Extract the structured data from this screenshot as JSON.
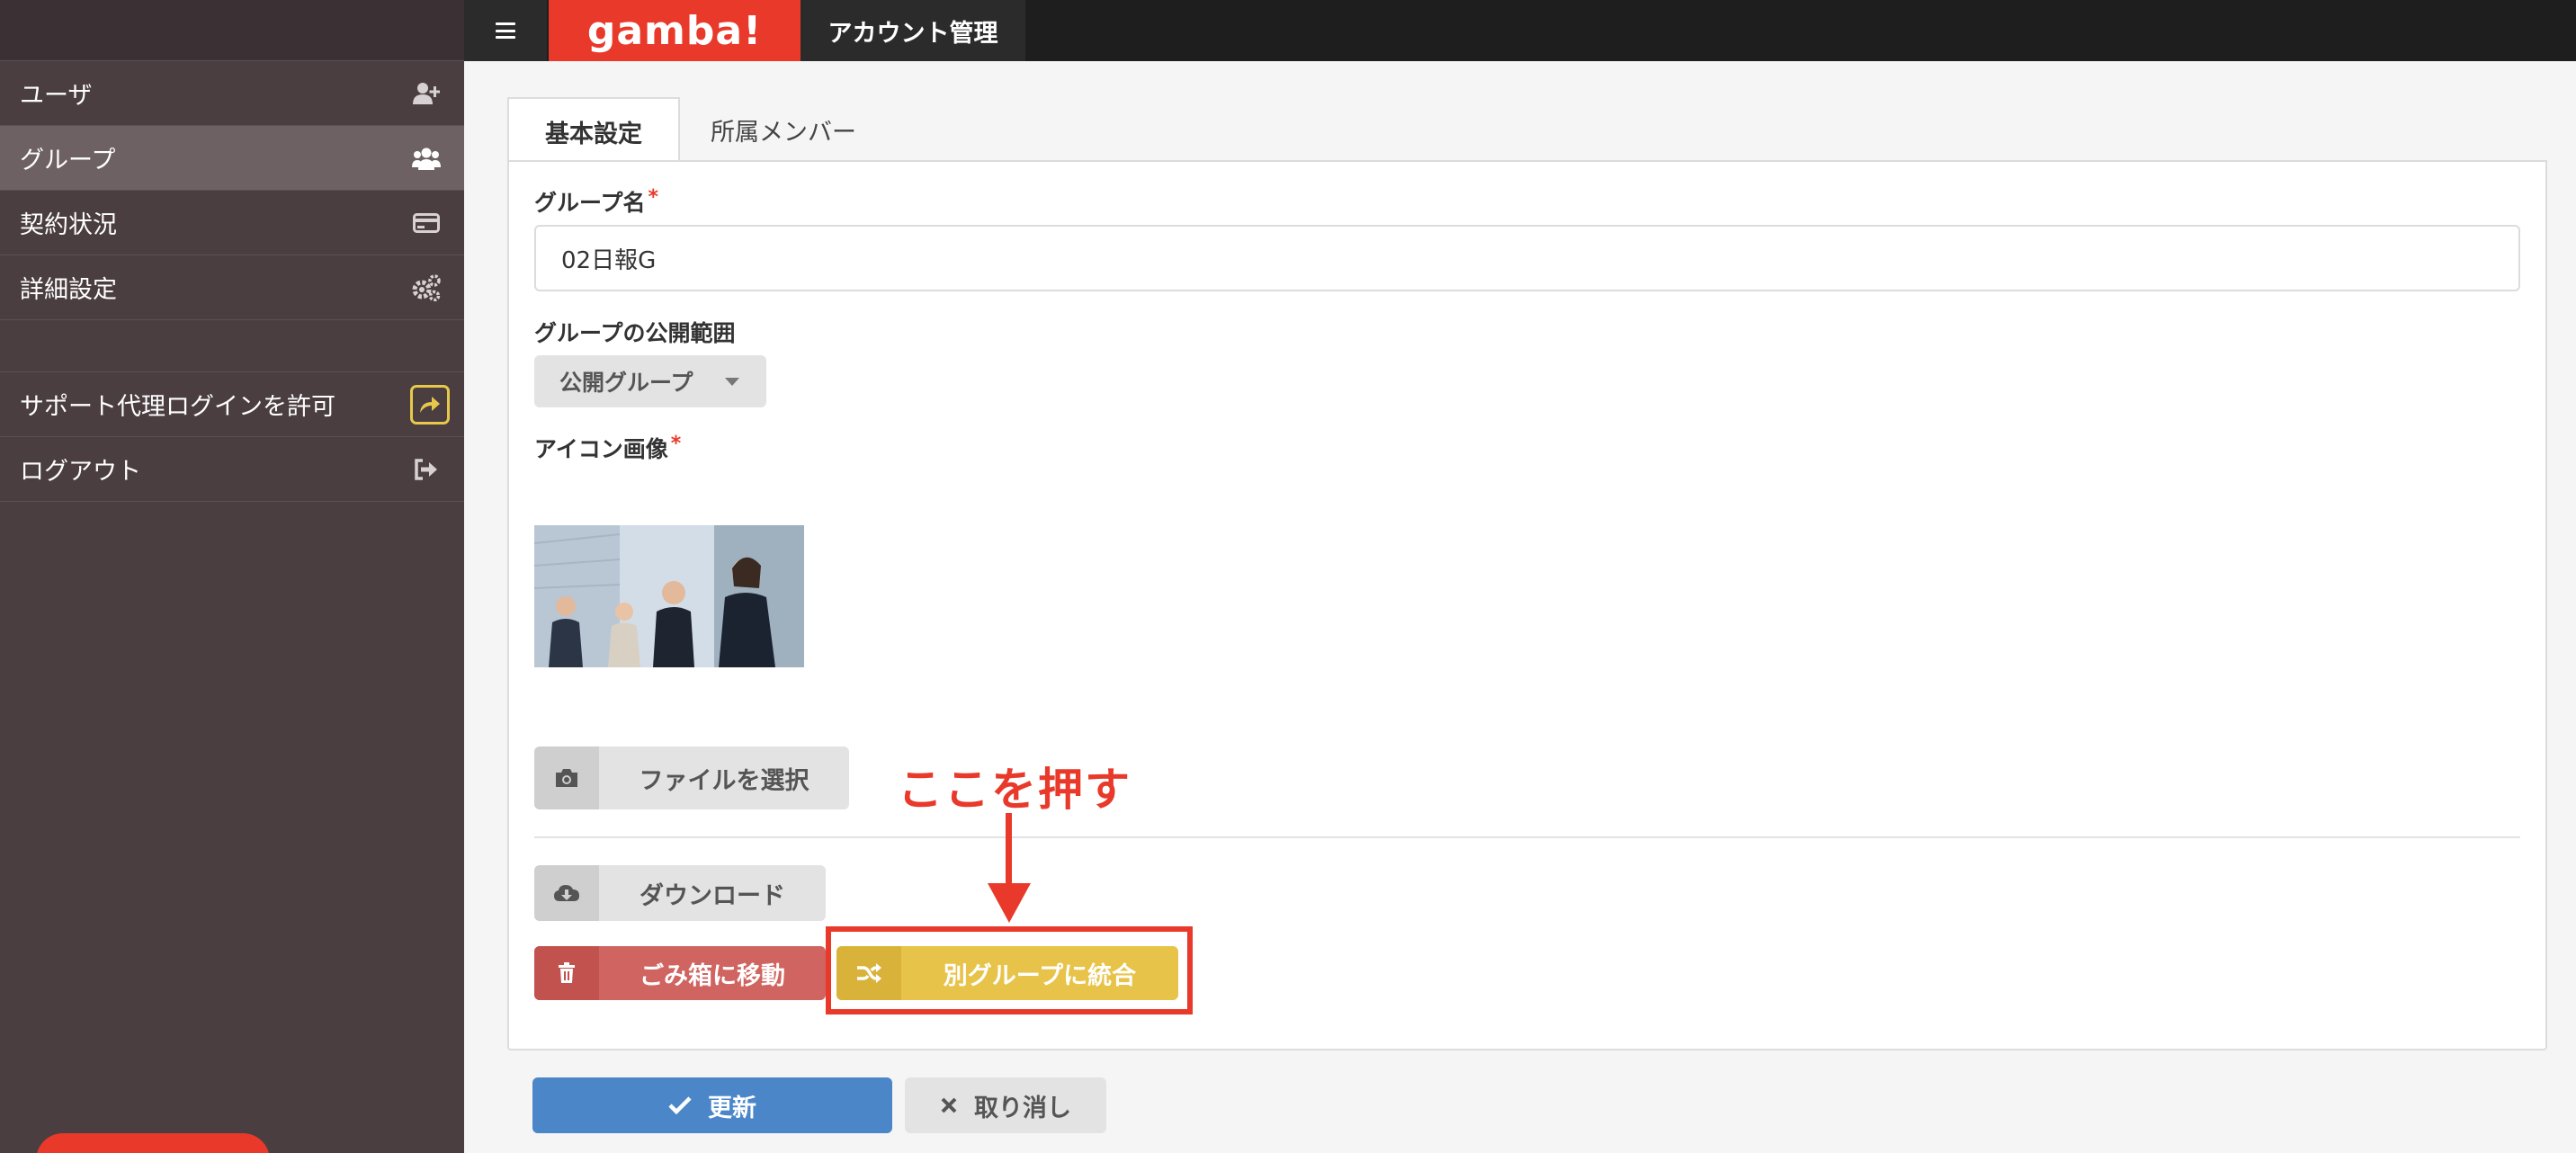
{
  "topbar": {
    "logo": "gamba!",
    "title": "アカウント管理"
  },
  "sidebar": {
    "items": [
      {
        "label": "ユーザ",
        "icon": "user-plus-icon"
      },
      {
        "label": "グループ",
        "icon": "users-icon",
        "active": true
      },
      {
        "label": "契約状況",
        "icon": "credit-card-icon"
      },
      {
        "label": "詳細設定",
        "icon": "gears-icon"
      },
      {
        "label": "サポート代理ログインを許可",
        "icon": "share-icon"
      },
      {
        "label": "ログアウト",
        "icon": "sign-out-icon"
      }
    ]
  },
  "tabs": {
    "basic": "基本設定",
    "members": "所属メンバー"
  },
  "form": {
    "group_name_label": "グループ名",
    "required_mark": "*",
    "group_name_value": "02日報G",
    "visibility_label": "グループの公開範囲",
    "visibility_value": "公開グループ",
    "icon_label": "アイコン画像"
  },
  "buttons": {
    "choose_file": "ファイルを選択",
    "download": "ダウンロード",
    "trash": "ごみ箱に移動",
    "merge": "別グループに統合",
    "update": "更新",
    "cancel": "取り消し"
  },
  "annotation": {
    "text": "ここを押す"
  },
  "colors": {
    "brand_red": "#e8392a",
    "sidebar_bg": "#4a3e41",
    "update_blue": "#4a86c8",
    "merge_yellow": "#e8c34a",
    "trash_red": "#d06460"
  }
}
